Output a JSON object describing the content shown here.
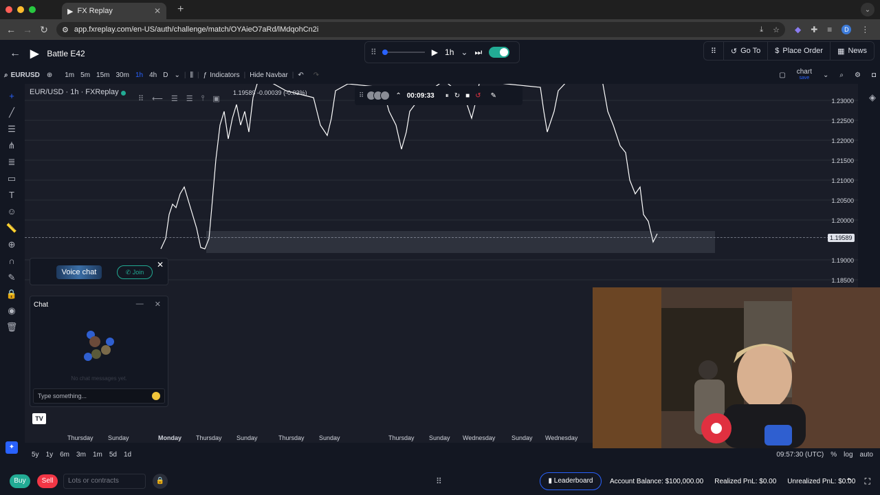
{
  "browser": {
    "tab_title": "FX Replay",
    "url": "app.fxreplay.com/en-US/auth/challenge/match/OYAieO7aRd/lMdqohCn2i",
    "profile_initial": "D"
  },
  "app": {
    "title": "Battle E42",
    "player": {
      "timeframe": "1h"
    },
    "actions": {
      "goto": "Go To",
      "place_order": "Place Order",
      "news": "News"
    }
  },
  "toolbar": {
    "symbol": "EURUSD",
    "timeframes": [
      "1m",
      "5m",
      "15m",
      "30m",
      "1h",
      "4h",
      "D"
    ],
    "active_timeframe": "1h",
    "indicators": "Indicators",
    "hide_navbar": "Hide Navbar",
    "chart_label": "chart",
    "chart_sublabel": "save"
  },
  "chart": {
    "title": "EUR/USD · 1h · FXReplay",
    "ohlc_text": "1.19589 -0.00039 (-0.03%)",
    "recording_time": "00:09:33",
    "price_labels": [
      "1.23000",
      "1.22500",
      "1.22000",
      "1.21500",
      "1.21000",
      "1.20500",
      "1.20000",
      "1.19500",
      "1.19000",
      "1.18500"
    ],
    "current_price": "1.19589",
    "time_labels": [
      "Thursday",
      "Sunday",
      "Monday",
      "Thursday",
      "Sunday",
      "Thursday",
      "Sunday",
      "Thursday",
      "Sunday",
      "Wednesday",
      "Sunday",
      "Wednesday"
    ]
  },
  "voice_chat": {
    "label": "Voice chat",
    "join": "Join"
  },
  "chat": {
    "title": "Chat",
    "empty_text": "No chat messages yet.",
    "placeholder": "Type something..."
  },
  "range_bar": {
    "ranges": [
      "5y",
      "1y",
      "6m",
      "3m",
      "1m",
      "5d",
      "1d"
    ],
    "clock": "09:57:30 (UTC)",
    "percent": "%",
    "log": "log",
    "auto": "auto"
  },
  "bottom": {
    "buy": "Buy",
    "sell": "Sell",
    "lots_placeholder": "Lots or contracts",
    "leaderboard": "Leaderboard",
    "account_balance": "Account Balance: $100,000.00",
    "realized_pnl": "Realized PnL: $0.00",
    "unrealized_pnl": "Unrealized PnL: $0.00"
  },
  "colors": {
    "accent": "#2962ff",
    "buy": "#22ab94",
    "sell": "#f23645",
    "background": "#131722"
  }
}
